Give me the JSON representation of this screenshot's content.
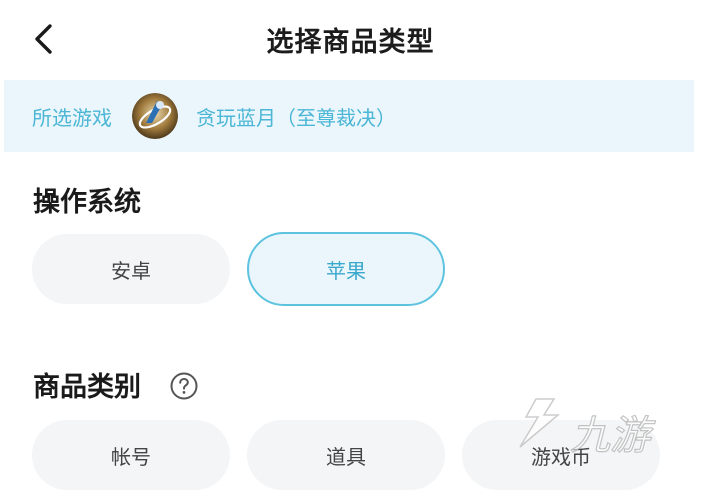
{
  "header": {
    "title": "选择商品类型",
    "back_icon": "chevron-left-icon"
  },
  "game_bar": {
    "label": "所选游戏",
    "game_name": "贪玩蓝月（至尊裁决）",
    "avatar": "game-avatar-image"
  },
  "os_section": {
    "title": "操作系统",
    "options": [
      {
        "label": "安卓",
        "selected": false
      },
      {
        "label": "苹果",
        "selected": true
      }
    ]
  },
  "category_section": {
    "title": "商品类别",
    "help_icon": "question-circle-icon",
    "options": [
      {
        "label": "帐号",
        "selected": false
      },
      {
        "label": "道具",
        "selected": false
      },
      {
        "label": "游戏币",
        "selected": false
      }
    ]
  },
  "watermark": {
    "text": "九游"
  },
  "colors": {
    "accent": "#4bb6d6",
    "accent_border": "#5ec3df",
    "chip_bg": "#f4f5f7",
    "banner_bg": "#eaf6fb"
  }
}
